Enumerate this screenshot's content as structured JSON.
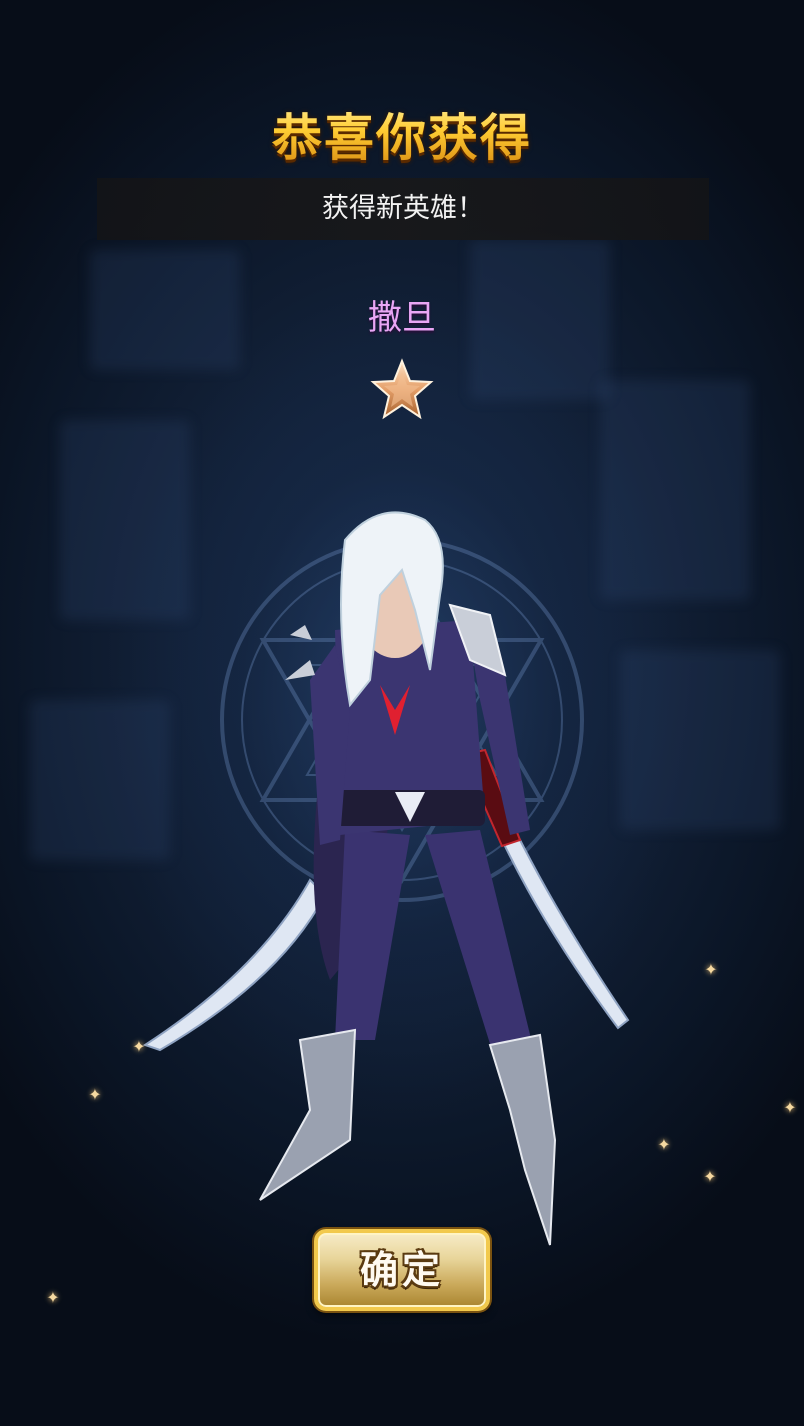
{
  "title": "恭喜你获得",
  "subtitle": "获得新英雄！",
  "hero": {
    "name": "撒旦",
    "stars": 1,
    "name_color": "#e9a6f5"
  },
  "confirm_label": "确定",
  "colors": {
    "title_gold": "#ffd24a",
    "background": "#0a1322",
    "button_border": "#f2c94c"
  },
  "icons": [
    "star-icon",
    "sparkle-icon",
    "magic-circle"
  ]
}
